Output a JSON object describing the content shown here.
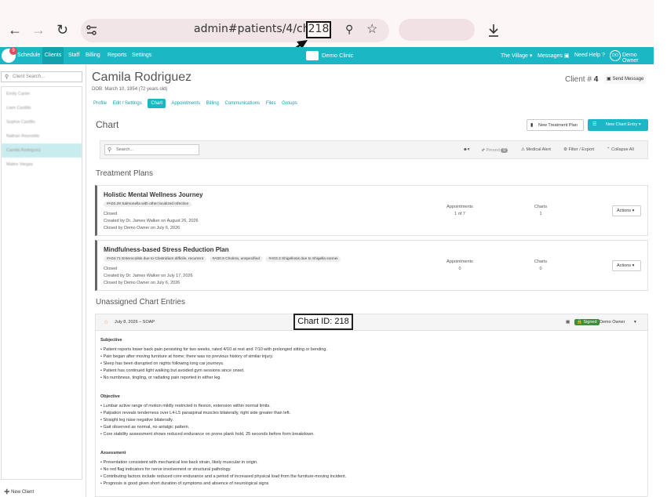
{
  "browser": {
    "url": "admin#patients/4/charts",
    "url_highlight": "218"
  },
  "header": {
    "badge_count": "9",
    "nav": [
      "Schedule",
      "Clients",
      "Staff",
      "Billing",
      "Reports",
      "Settings"
    ],
    "clinic_name": "Demo Clinic",
    "right": {
      "location": "The Village",
      "messages": "Messages",
      "help": "Need Help ?",
      "avatar": "DO",
      "user": "Demo Owner"
    }
  },
  "sidebar": {
    "search_placeholder": "Client Search...",
    "clients": [
      "Emily Carter",
      "Liam Castillo",
      "Sophia Castillo",
      "Nathan Reynolds",
      "Camila Rodriguez",
      "Mateo Vargas"
    ],
    "selected_index": 4,
    "new_client": "New Client"
  },
  "patient": {
    "name": "Camila Rodriguez",
    "dob": "DOB: March 10, 1954 (72 years old)",
    "client_label": "Client #",
    "client_number": "4",
    "send_message": "Send Message"
  },
  "tabs": [
    "Profile",
    "Edit / Settings",
    "Chart",
    "Appointments",
    "Billing",
    "Communications",
    "Files",
    "Groups"
  ],
  "active_tab": "Chart",
  "chart": {
    "title": "Chart",
    "new_treatment_plan": "New Treatment Plan",
    "new_chart_entry": "New Chart Entry",
    "search_placeholder": "Search...",
    "pinned": "Pinned",
    "pinned_count": "0",
    "medical_alert": "Medical Alert",
    "filter_export": "Filter / Export",
    "collapse_all": "Collapse All"
  },
  "treatment_plans": {
    "heading": "Treatment Plans",
    "plans": [
      {
        "title": "Holistic Mental Wellness Journey",
        "codes": [
          "#A02.29 Salmonella with other localized infection"
        ],
        "status": "Closed",
        "created": "Created by Dr. James Walker on August 26, 2026",
        "closed": "Closed by Demo Owner on July 6, 2026",
        "appointments_label": "Appointments",
        "appointments": "1 of 7",
        "charts_label": "Charts",
        "charts": "1",
        "actions": "Actions"
      },
      {
        "title": "Mindfulness-based Stress Reduction Plan",
        "codes": [
          "#A04.71 Enterocolitis due to Clostridium difficile, recurrent",
          "#A00.9 Cholera, unspecified",
          "#A03.3 Shigellosis due to Shigella sonnei"
        ],
        "status": "Closed",
        "created": "Created by Dr. James Walker on July 17, 2026",
        "closed": "Closed by Demo Owner on July 6, 2026",
        "appointments_label": "Appointments",
        "appointments": "0",
        "charts_label": "Charts",
        "charts": "0",
        "actions": "Actions"
      }
    ]
  },
  "unassigned": {
    "heading": "Unassigned Chart Entries",
    "entry": {
      "date": "July 8, 2026 – SOAP",
      "chart_id_label": "Chart ID: 218",
      "signed": "Signed",
      "author": "Demo Owner",
      "subjective_h": "Subjective",
      "subjective": [
        "Patient reports lower back pain persisting for two weeks, rated 4/10 at rest and 7/10 with prolonged sitting or bending.",
        "Pain began after moving furniture at home; there was no previous history of similar injury.",
        "Sleep has been disrupted on nights following long car journeys.",
        "Patient has continued light walking but avoided gym sessions since onset.",
        "No numbness, tingling, or radiating pain reported in either leg."
      ],
      "objective_h": "Objective",
      "objective": [
        "Lumbar active range of motion mildly restricted in flexion, extension within normal limits.",
        "Palpation reveals tenderness over L4-L5 paraspinal muscles bilaterally, right side greater than left.",
        "Straight leg raise negative bilaterally.",
        "Gait observed as normal, no antalgic pattern.",
        "Core stability assessment shows reduced endurance on prone plank hold, 25 seconds before form breakdown."
      ],
      "assessment_h": "Assessment",
      "assessment": [
        "Presentation consistent with mechanical low back strain, likely muscular in origin.",
        "No red flag indicators for nerve involvement or structural pathology.",
        "Contributing factors include reduced core endurance and a period of increased physical load from the furniture-moving incident.",
        "Prognosis is good given short duration of symptoms and absence of neurological signs"
      ]
    }
  },
  "colors": {
    "accent": "#1bb7c4",
    "signed": "#3e8e3e"
  }
}
